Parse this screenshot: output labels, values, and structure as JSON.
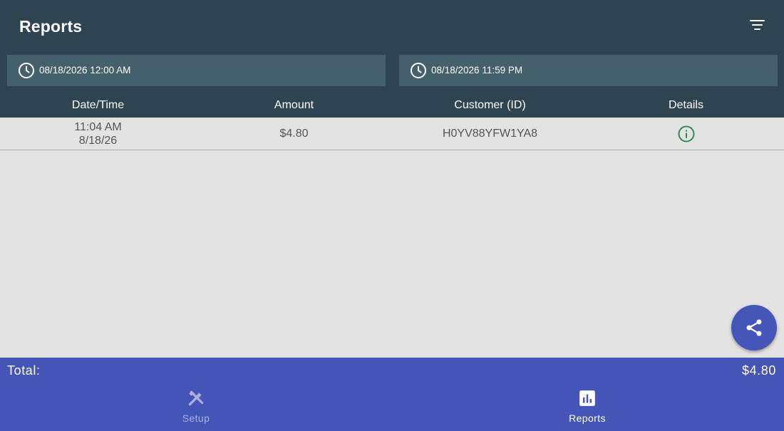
{
  "header": {
    "title": "Reports"
  },
  "date_range": {
    "start": "08/18/2026 12:00 AM",
    "end": "08/18/2026 11:59 PM"
  },
  "table": {
    "columns": [
      "Date/Time",
      "Amount",
      "Customer (ID)",
      "Details"
    ],
    "rows": [
      {
        "time": "11:04 AM",
        "date": "8/18/26",
        "amount": "$4.80",
        "customer": "H0YV88YFW1YA8"
      }
    ]
  },
  "summary": {
    "total_label": "Total:",
    "total_value": "$4.80"
  },
  "nav": {
    "setup_label": "Setup",
    "reports_label": "Reports"
  },
  "colors": {
    "appbar": "#2e4450",
    "date_box": "#45606d",
    "accent": "#4555b7",
    "info_icon": "#2e8b57"
  },
  "icons": {
    "filter": "filter-icon",
    "clock": "clock-icon",
    "info": "info-icon",
    "share": "share-icon",
    "setup": "tools-icon",
    "reports": "bar-chart-icon"
  }
}
